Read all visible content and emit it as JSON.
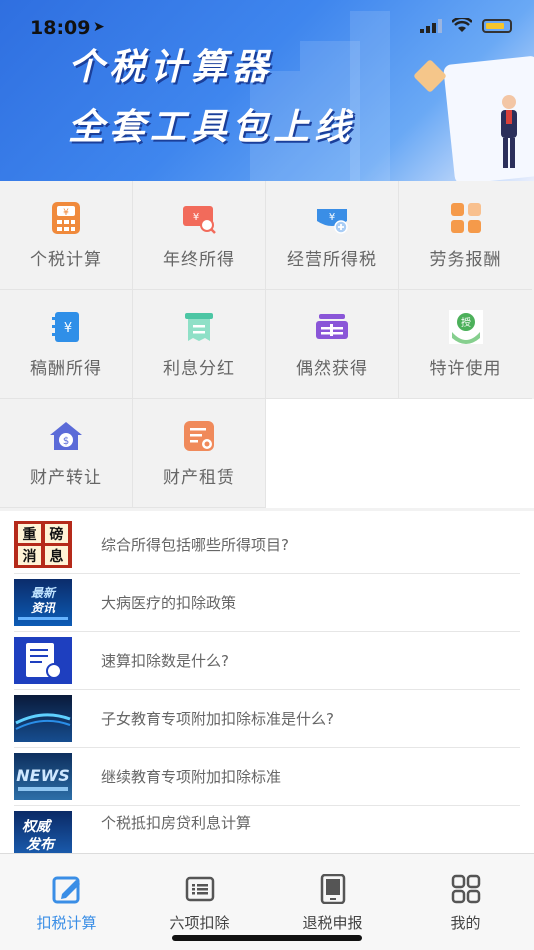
{
  "status": {
    "time": "18:09"
  },
  "banner": {
    "title_line1": "个税计算器",
    "title_line2": "全套工具包上线"
  },
  "tools": [
    {
      "label": "个税计算",
      "icon": "calculator-icon",
      "color": "#f08a3c"
    },
    {
      "label": "年终所得",
      "icon": "ticket-search-icon",
      "color": "#f26b5b"
    },
    {
      "label": "经营所得税",
      "icon": "money-add-icon",
      "color": "#3a8ee6"
    },
    {
      "label": "劳务报酬",
      "icon": "apps-grid-icon",
      "color": "#f59a4a"
    },
    {
      "label": "稿酬所得",
      "icon": "notebook-yen-icon",
      "color": "#2f8fe8"
    },
    {
      "label": "利息分红",
      "icon": "receipt-icon",
      "color": "#4cc6a4"
    },
    {
      "label": "偶然获得",
      "icon": "ticket-stub-icon",
      "color": "#8a56d8"
    },
    {
      "label": "特许使用",
      "icon": "grant-hands-icon",
      "color": "#4cb05a"
    },
    {
      "label": "财产转让",
      "icon": "house-money-icon",
      "color": "#5b6bd8"
    },
    {
      "label": "财产租赁",
      "icon": "lease-doc-icon",
      "color": "#f08a5b"
    }
  ],
  "news": [
    {
      "title": "综合所得包括哪些所得项目?",
      "thumb_text": "重磅消息"
    },
    {
      "title": "大病医疗的扣除政策",
      "thumb_text": "最新资讯"
    },
    {
      "title": "速算扣除数是什么?",
      "thumb_text": ""
    },
    {
      "title": "子女教育专项附加扣除标准是什么?",
      "thumb_text": ""
    },
    {
      "title": "继续教育专项附加扣除标准",
      "thumb_text": "NEWS"
    },
    {
      "title": "个税抵扣房贷利息计算",
      "thumb_text": "权威发布"
    }
  ],
  "tabs": [
    {
      "label": "扣税计算",
      "icon": "edit-calc-icon",
      "active": true
    },
    {
      "label": "六项扣除",
      "icon": "list-card-icon",
      "active": false
    },
    {
      "label": "退税申报",
      "icon": "tablet-icon",
      "active": false
    },
    {
      "label": "我的",
      "icon": "grid-apps-icon",
      "active": false
    }
  ],
  "colors": {
    "accent": "#3a8ee6",
    "banner": "#3f86ee"
  }
}
